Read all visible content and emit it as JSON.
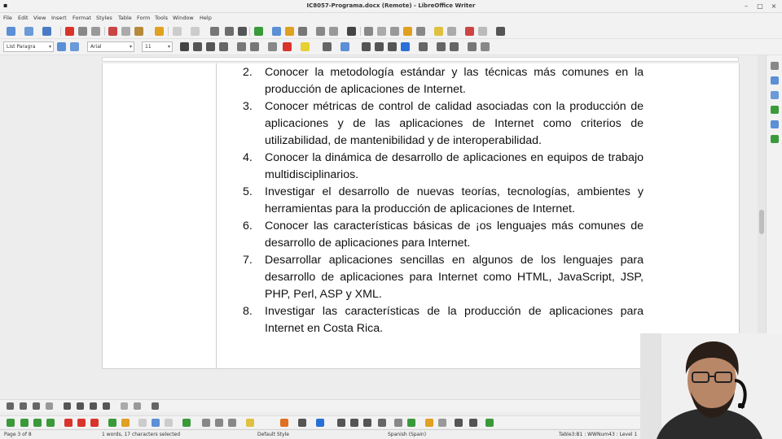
{
  "window": {
    "title": "IC8057-Programa.docx (Remote) - LibreOffice Writer",
    "controls": [
      "–",
      "□",
      "×"
    ]
  },
  "menu": [
    "File",
    "Edit",
    "View",
    "Insert",
    "Format",
    "Styles",
    "Table",
    "Form",
    "Tools",
    "Window",
    "Help"
  ],
  "formatting": {
    "paragraph_style": "List Paragra",
    "font_name": "Arial",
    "font_size": "11"
  },
  "document": {
    "items": [
      {
        "num": "2.",
        "text": "Conocer la metodología estándar y las técnicas más comunes en la producción de aplicaciones de Internet."
      },
      {
        "num": "3.",
        "text": "Conocer métricas de control de calidad asociadas con la producción de aplicaciones y de las aplicaciones de Internet como criterios de utilizabilidad, de mantenibilidad y de interoperabilidad."
      },
      {
        "num": "4.",
        "text": "Conocer la dinámica de desarrollo de aplicaciones en equipos de trabajo multidisciplinarios."
      },
      {
        "num": "5.",
        "text": "Investigar el desarrollo de nuevas teorías, tecnologías, ambientes y herramientas para la producción de aplicaciones de Internet."
      },
      {
        "num": "6.",
        "text": "Conocer las características básicas de ¡os lenguajes más comunes de desarrollo de aplicaciones para Internet."
      },
      {
        "num": "7.",
        "text": "Desarrollar aplicaciones sencillas en algunos de los lenguajes para desarrollo de aplicaciones para Internet como HTML, JavaScript, JSP, PHP, Perl, ASP y XML."
      },
      {
        "num": "8.",
        "text": "Investigar las características de la producción de aplicaciones para Internet en Costa Rica."
      }
    ]
  },
  "status": {
    "page": "Page 3 of 8",
    "selection": "1 words, 17 characters selected",
    "page_style": "Default Style",
    "language": "Spanish (Spain)",
    "cell": "Table3:B1 : WWNum43 : Level 1"
  },
  "colors": {
    "accent": "#2a6fd6",
    "warn": "#e0a020",
    "red": "#d9342b",
    "green": "#3a9a3a"
  }
}
